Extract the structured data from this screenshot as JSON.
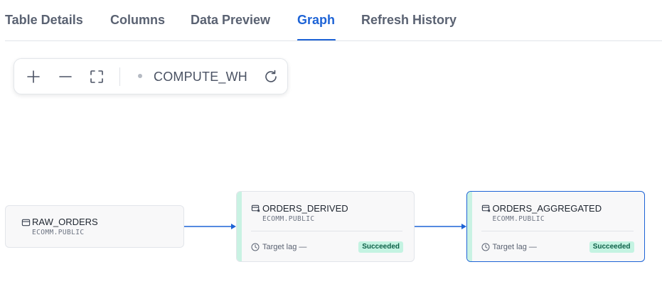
{
  "tabs": {
    "items": [
      {
        "label": "Table Details",
        "active": false
      },
      {
        "label": "Columns",
        "active": false
      },
      {
        "label": "Data Preview",
        "active": false
      },
      {
        "label": "Graph",
        "active": true
      },
      {
        "label": "Refresh History",
        "active": false
      }
    ]
  },
  "toolbar": {
    "zoom_in_icon": "plus-icon",
    "zoom_out_icon": "minus-icon",
    "fit_icon": "fullscreen-icon",
    "refresh_icon": "refresh-icon",
    "warehouse": "COMPUTE_WH"
  },
  "graph": {
    "nodes": [
      {
        "name": "RAW_ORDERS",
        "schema": "ECOMM.PUBLIC",
        "icon": "table-icon"
      },
      {
        "name": "ORDERS_DERIVED",
        "schema": "ECOMM.PUBLIC",
        "icon": "dynamic-table-icon",
        "lag_label": "Target lag —",
        "status": "Succeeded"
      },
      {
        "name": "ORDERS_AGGREGATED",
        "schema": "ECOMM.PUBLIC",
        "icon": "dynamic-table-icon",
        "lag_label": "Target lag —",
        "status": "Succeeded",
        "selected": true
      }
    ]
  },
  "colors": {
    "accent": "#1d63d6",
    "success_bg": "#c4f3e2",
    "success_text": "#0d5f47",
    "node_accent": "#c9f2e3"
  }
}
